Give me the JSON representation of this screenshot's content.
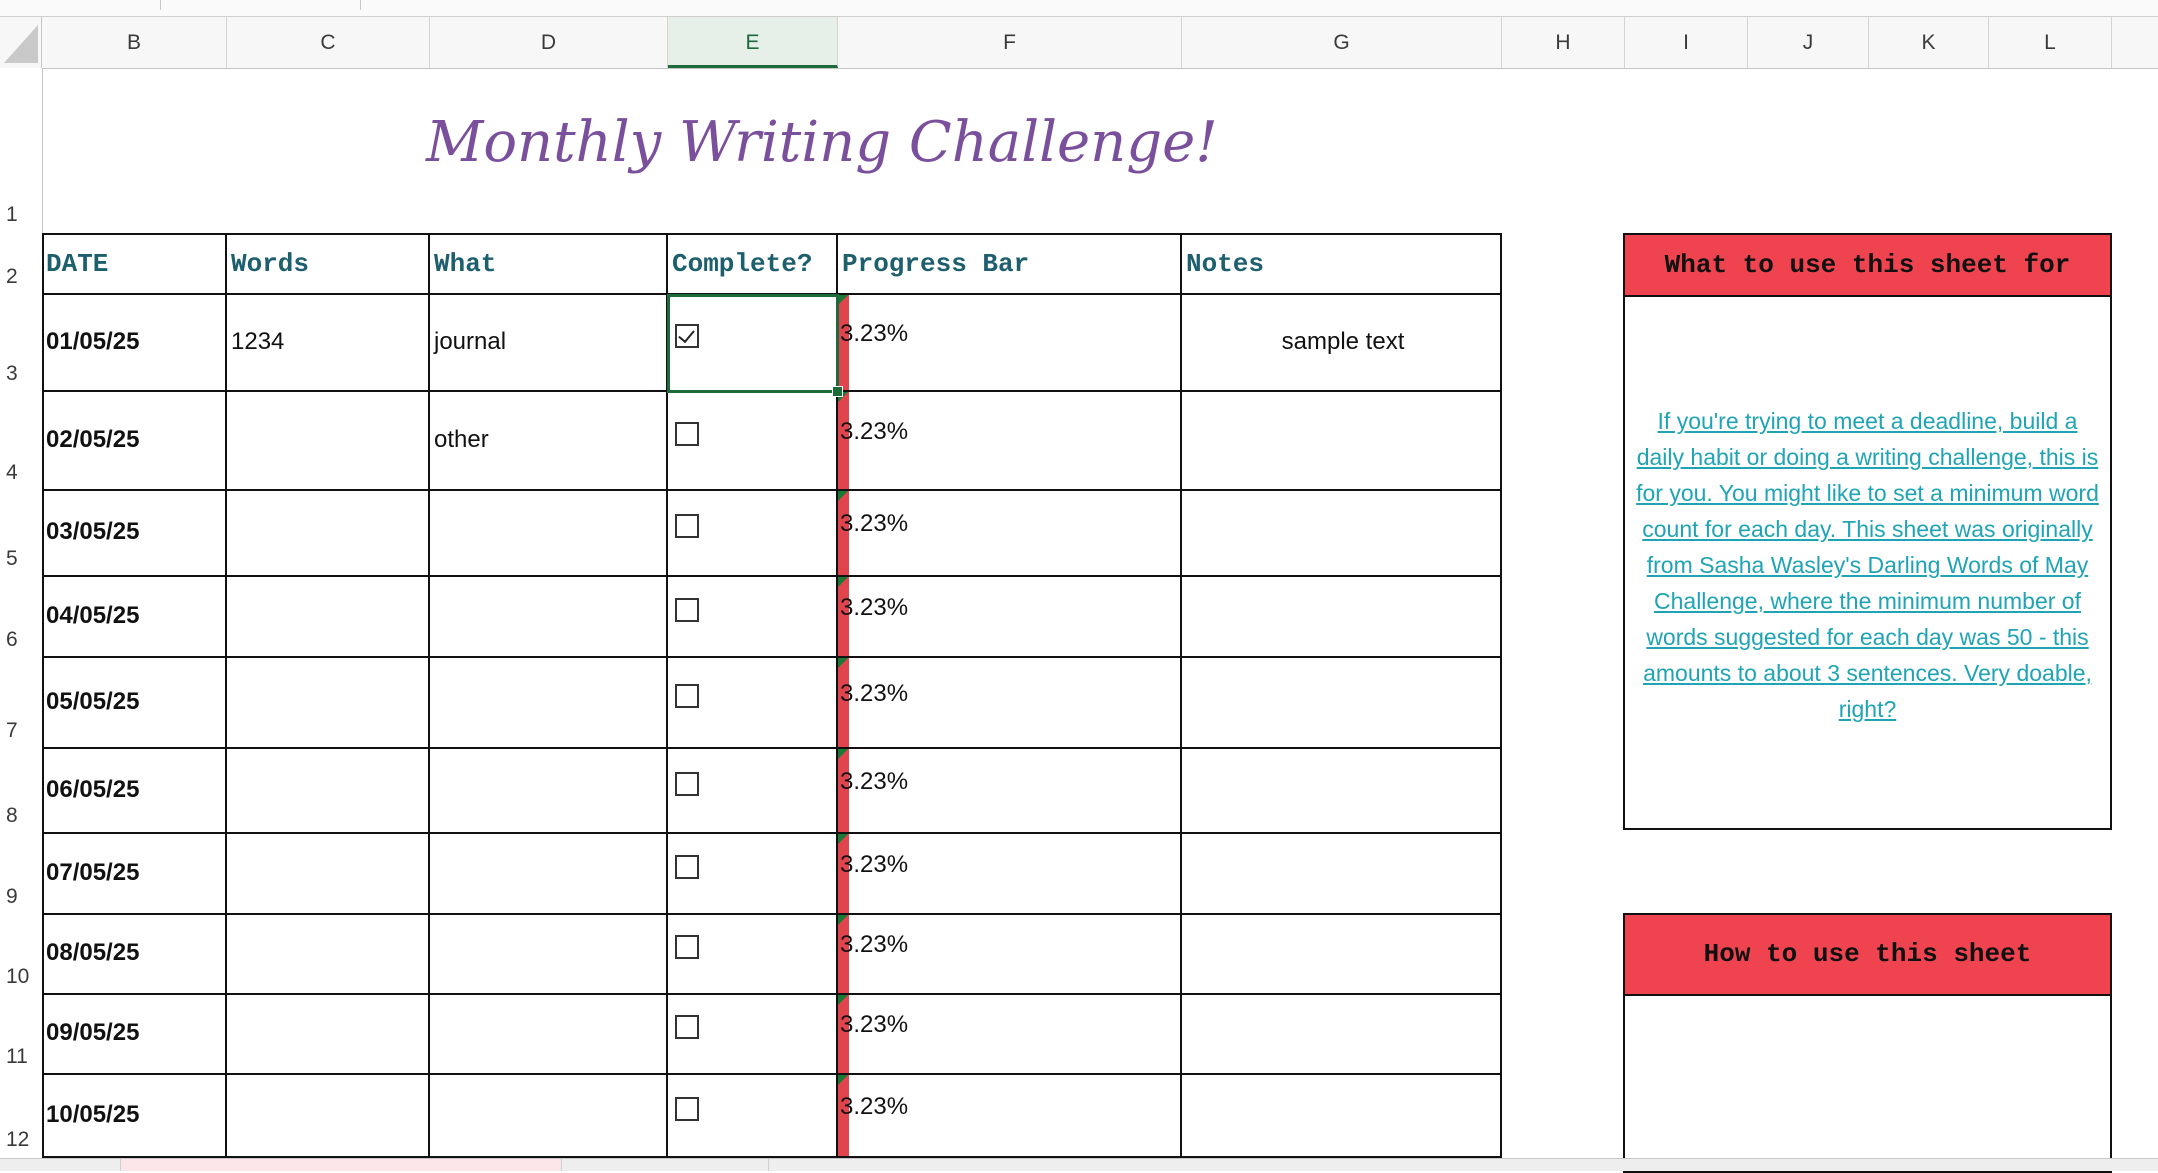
{
  "sheet": {
    "title": "Monthly Writing Challenge!",
    "columns": [
      "B",
      "C",
      "D",
      "E",
      "F",
      "G",
      "H",
      "I",
      "J",
      "K",
      "L"
    ],
    "active_column": "E",
    "rows": [
      "1",
      "2",
      "3",
      "4",
      "5",
      "6",
      "7",
      "8",
      "9",
      "10",
      "11",
      "12"
    ],
    "headers": {
      "date": "DATE",
      "words": "Words",
      "what": "What",
      "complete": "Complete?",
      "progress": "Progress Bar",
      "notes": "Notes"
    },
    "entries": [
      {
        "date": "01/05/25",
        "words": "1234",
        "what": "journal",
        "complete": true,
        "progress": "3.23%",
        "progress_value": 3.23,
        "notes": "sample text"
      },
      {
        "date": "02/05/25",
        "words": "",
        "what": "other",
        "complete": false,
        "progress": "3.23%",
        "progress_value": 3.23,
        "notes": ""
      },
      {
        "date": "03/05/25",
        "words": "",
        "what": "",
        "complete": false,
        "progress": "3.23%",
        "progress_value": 3.23,
        "notes": ""
      },
      {
        "date": "04/05/25",
        "words": "",
        "what": "",
        "complete": false,
        "progress": "3.23%",
        "progress_value": 3.23,
        "notes": ""
      },
      {
        "date": "05/05/25",
        "words": "",
        "what": "",
        "complete": false,
        "progress": "3.23%",
        "progress_value": 3.23,
        "notes": ""
      },
      {
        "date": "06/05/25",
        "words": "",
        "what": "",
        "complete": false,
        "progress": "3.23%",
        "progress_value": 3.23,
        "notes": ""
      },
      {
        "date": "07/05/25",
        "words": "",
        "what": "",
        "complete": false,
        "progress": "3.23%",
        "progress_value": 3.23,
        "notes": ""
      },
      {
        "date": "08/05/25",
        "words": "",
        "what": "",
        "complete": false,
        "progress": "3.23%",
        "progress_value": 3.23,
        "notes": ""
      },
      {
        "date": "09/05/25",
        "words": "",
        "what": "",
        "complete": false,
        "progress": "3.23%",
        "progress_value": 3.23,
        "notes": ""
      },
      {
        "date": "10/05/25",
        "words": "",
        "what": "",
        "complete": false,
        "progress": "3.23%",
        "progress_value": 3.23,
        "notes": ""
      }
    ]
  },
  "panels": {
    "what_for": {
      "title": "What to use this sheet for",
      "body": "If you're trying to meet a deadline, build a daily habit or doing a writing challenge, this is for you. You might like to set a minimum word count for each day. This sheet was originally from Sasha Wasley's Darling Words of May Challenge, where the minimum number of words suggested for each day was 50 - this amounts to about 3 sentences. Very doable, right?"
    },
    "how_to": {
      "title": "How to use this sheet"
    }
  },
  "colors": {
    "title": "#7a4f9c",
    "header_text": "#1e5f6e",
    "panel_header": "#ef4450",
    "progress_bar": "#e0444c",
    "link_text": "#1fa4b5",
    "selection": "#1d6b3a"
  }
}
